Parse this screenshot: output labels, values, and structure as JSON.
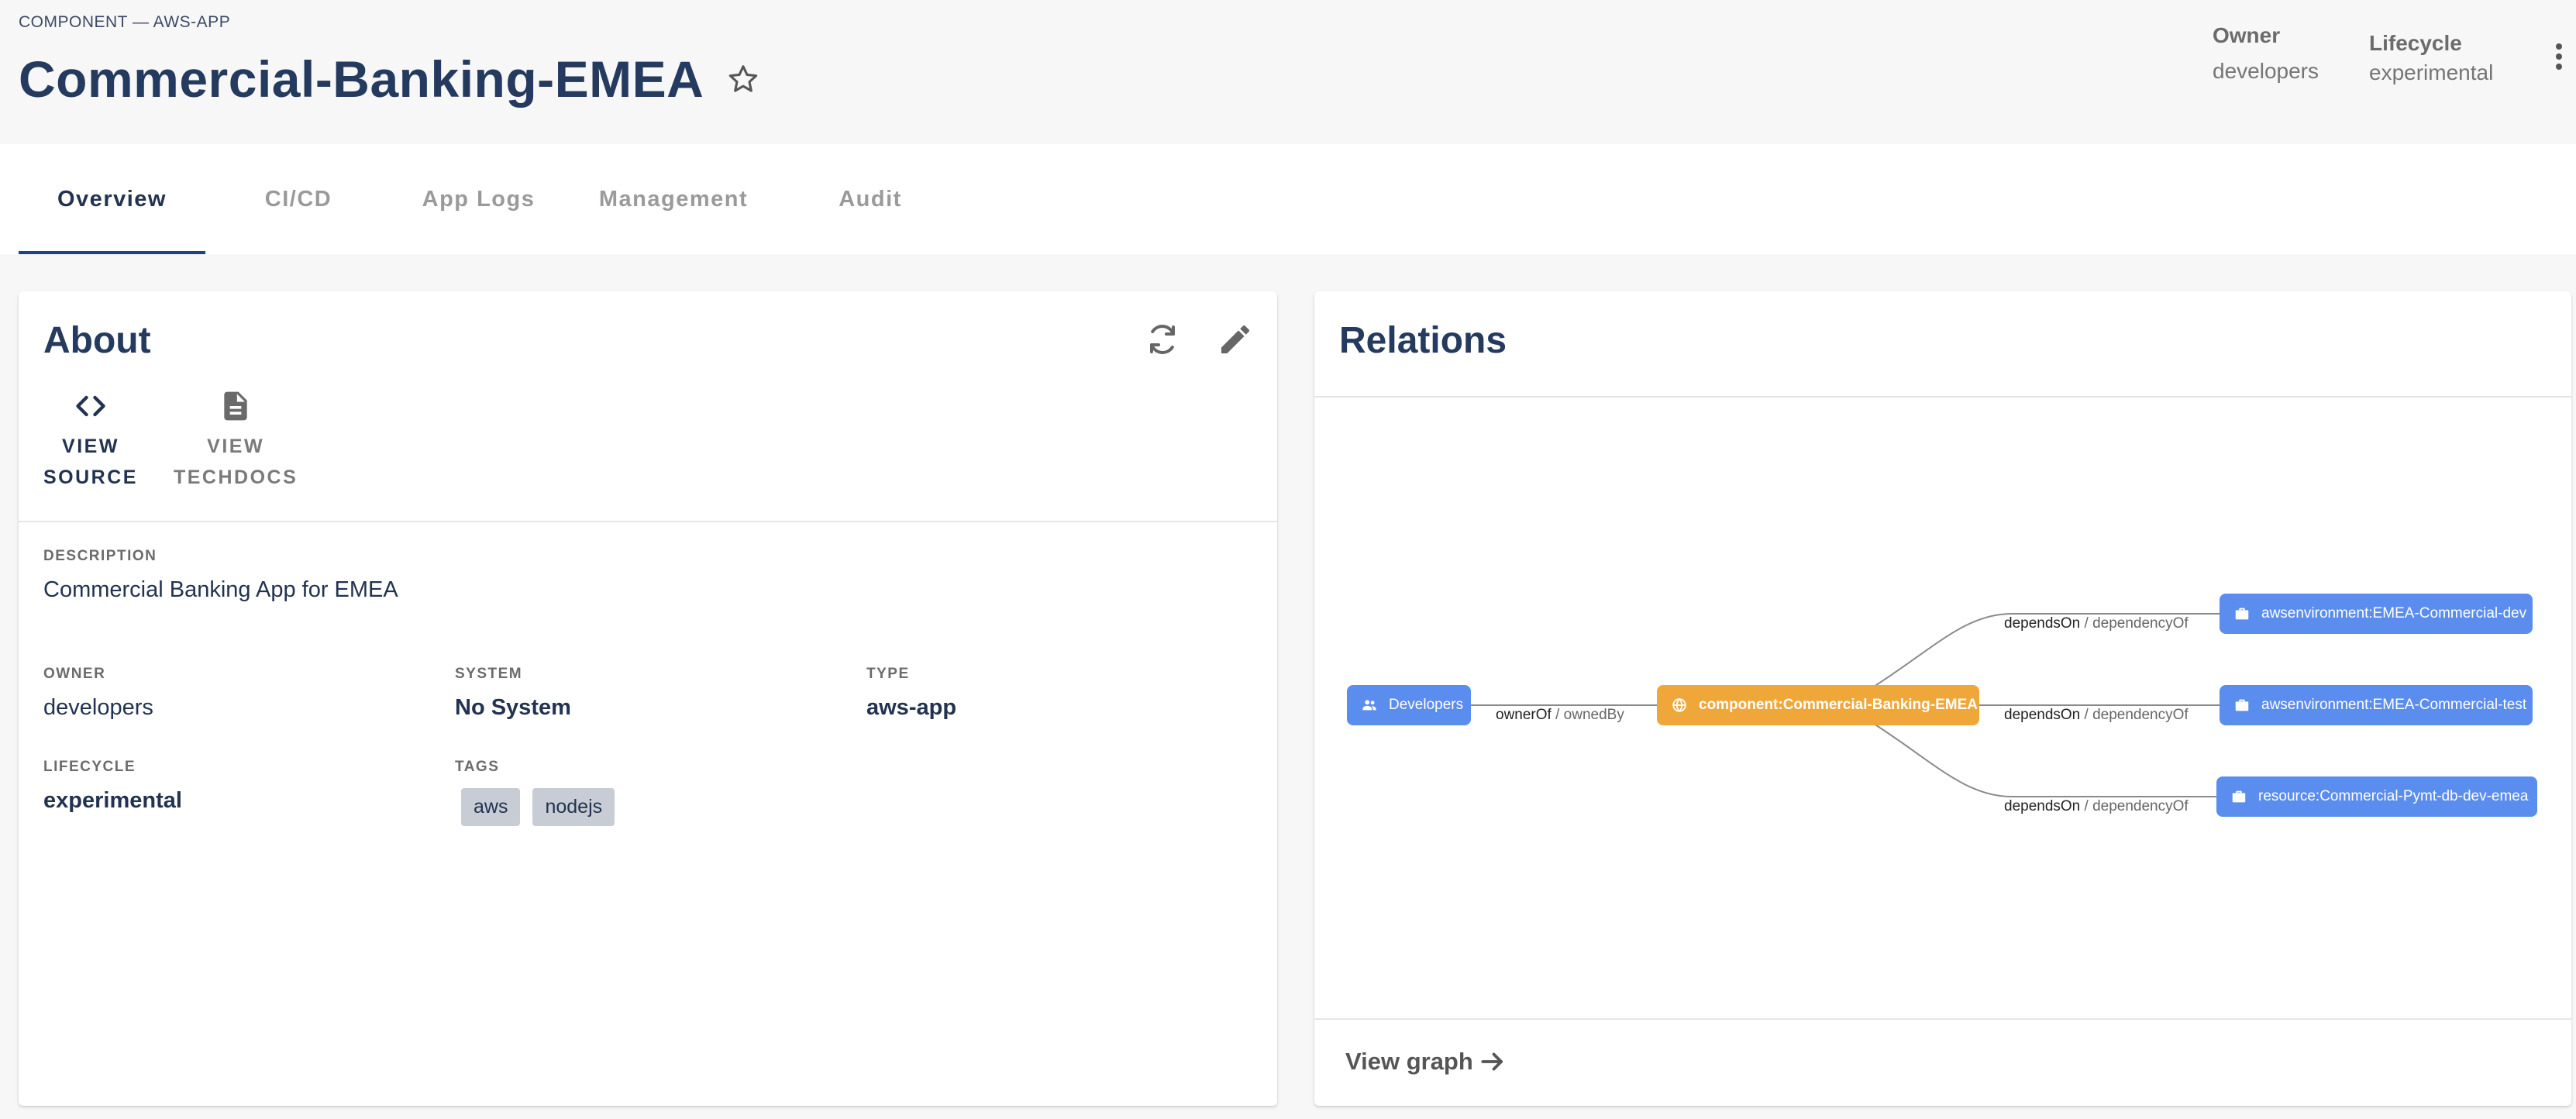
{
  "header": {
    "kicker": "COMPONENT — AWS-APP",
    "title": "Commercial-Banking-EMEA",
    "owner_label": "Owner",
    "owner_value": "developers",
    "lifecycle_label": "Lifecycle",
    "lifecycle_value": "experimental"
  },
  "tabs": [
    {
      "label": "Overview",
      "active": true
    },
    {
      "label": "CI/CD"
    },
    {
      "label": "App Logs"
    },
    {
      "label": "Management"
    },
    {
      "label": "Audit"
    }
  ],
  "about": {
    "title": "About",
    "links": {
      "source_line1": "VIEW",
      "source_line2": "SOURCE",
      "techdocs_line1": "VIEW",
      "techdocs_line2": "TECHDOCS"
    },
    "description_label": "DESCRIPTION",
    "description": "Commercial Banking App for EMEA",
    "owner_label": "OWNER",
    "owner": "developers",
    "system_label": "SYSTEM",
    "system": "No System",
    "type_label": "TYPE",
    "type": "aws-app",
    "lifecycle_label": "LIFECYCLE",
    "lifecycle": "experimental",
    "tags_label": "TAGS",
    "tags": [
      "aws",
      "nodejs"
    ]
  },
  "relations": {
    "title": "Relations",
    "nodes": {
      "developers": "Developers",
      "component": "component:Commercial-Banking-EMEA",
      "env_dev": "awsenvironment:EMEA-Commercial-dev",
      "env_test": "awsenvironment:EMEA-Commercial-test",
      "resource_db": "resource:Commercial-Pymt-db-dev-emea"
    },
    "edges": {
      "owner_rel": "ownerOf",
      "owner_inv": "ownedBy",
      "dep_rel": "dependsOn",
      "dep_inv": "dependencyOf",
      "separator": "/"
    },
    "view_graph_label": "View graph"
  },
  "colors": {
    "primary": "#243a5e",
    "node_blue": "#5b8def",
    "node_orange": "#f0a73a",
    "tab_indicator": "#1f4287"
  }
}
